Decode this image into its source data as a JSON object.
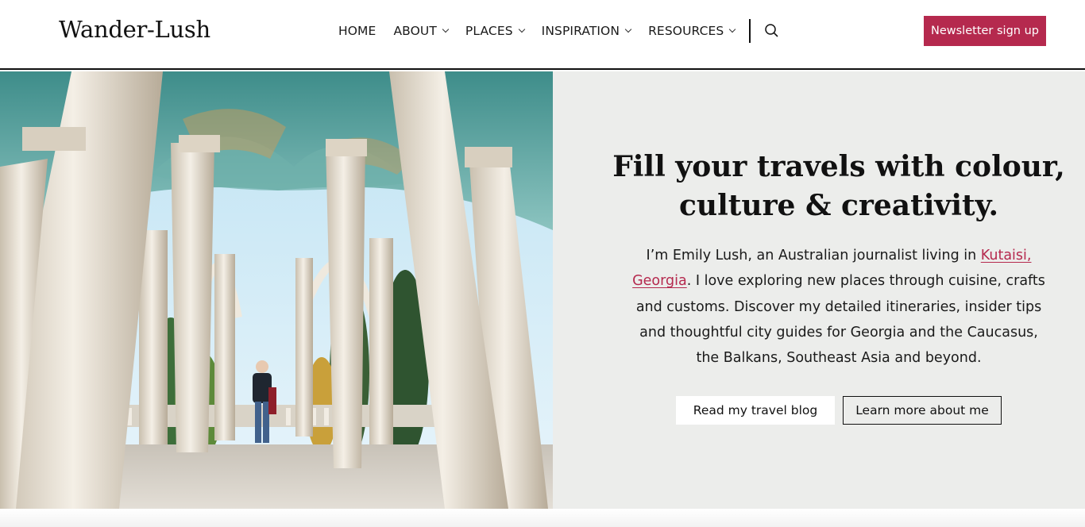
{
  "header": {
    "logo": "Wander-Lush",
    "nav": [
      {
        "label": "HOME",
        "dropdown": false
      },
      {
        "label": "ABOUT",
        "dropdown": true
      },
      {
        "label": "PLACES",
        "dropdown": true
      },
      {
        "label": "INSPIRATION",
        "dropdown": true
      },
      {
        "label": "RESOURCES",
        "dropdown": true
      }
    ],
    "search_icon": "search-icon",
    "newsletter_label": "Newsletter sign up"
  },
  "hero": {
    "title_line1": "Fill your travels with colour,",
    "title_line2": "culture & creativity.",
    "intro_before": "I’m Emily Lush, an Australian journalist living in ",
    "intro_link": "Kutaisi, Georgia",
    "intro_after": ". I love exploring new places through cuisine, crafts and customs. Discover my detailed itineraries, insider tips and thoughtful city guides for Georgia and the Caucasus, the Balkans, Southeast Asia and beyond.",
    "primary_button": "Read my travel blog",
    "secondary_button": "Learn more about me"
  },
  "colors": {
    "accent": "#b5294e",
    "panel_bg": "#ecedeb"
  }
}
